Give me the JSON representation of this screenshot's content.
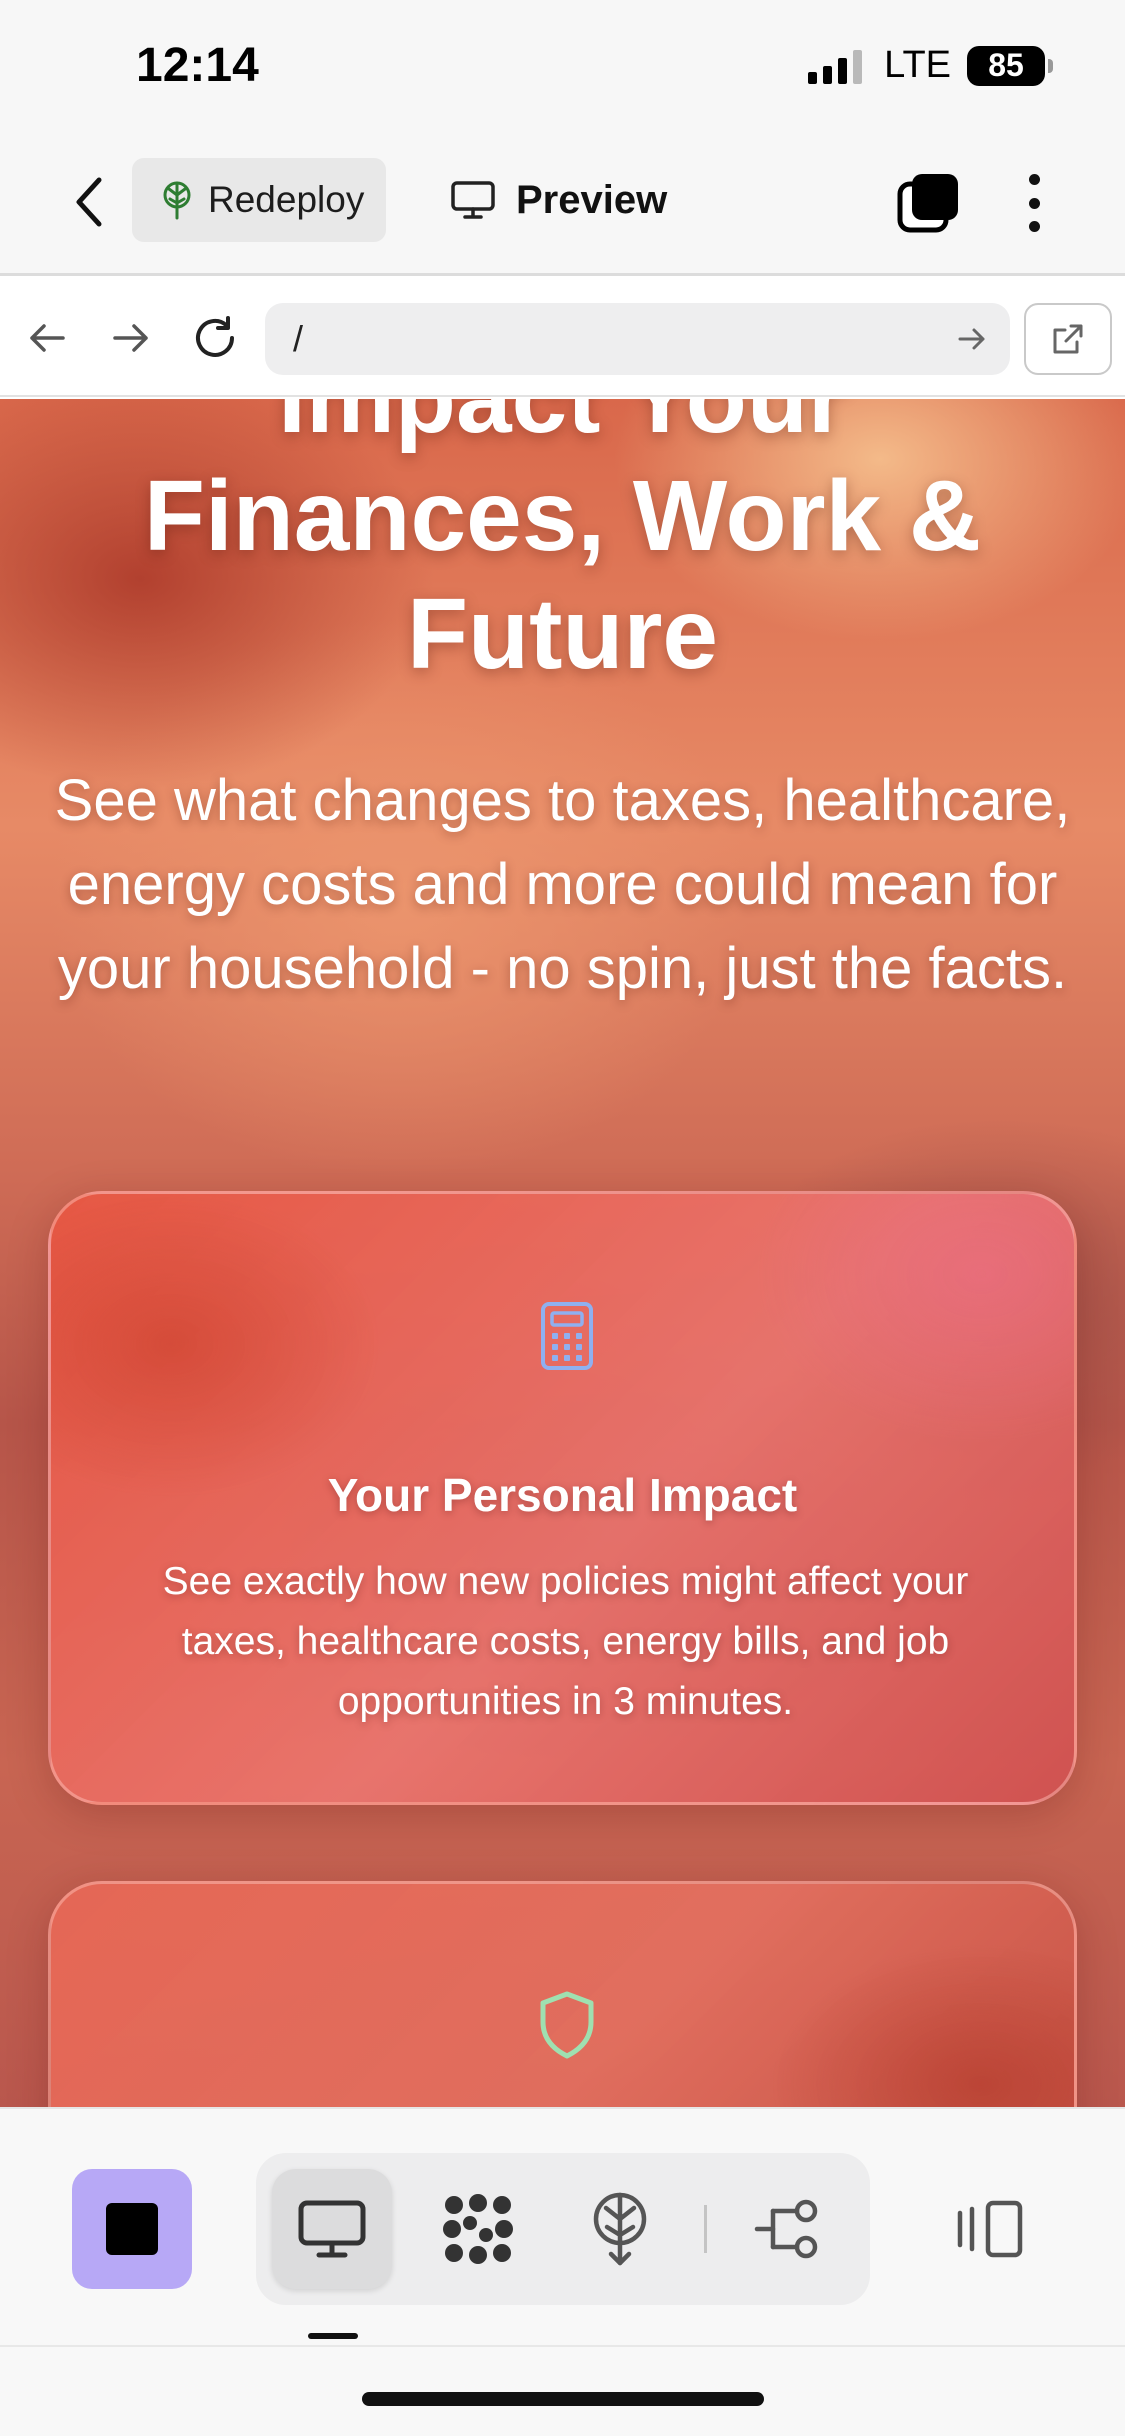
{
  "status_bar": {
    "time": "12:14",
    "network": "LTE",
    "battery": "85"
  },
  "app_bar": {
    "redeploy_label": "Redeploy",
    "preview_label": "Preview"
  },
  "browser": {
    "url": "/"
  },
  "hero": {
    "title_line_1": "Impact Your",
    "title_line_2": "Finances, Work &",
    "title_line_3": "Future",
    "subtitle": "See what changes to taxes, healthcare, energy costs and more could mean for your household - no spin, just the facts."
  },
  "cards": [
    {
      "icon": "calculator-icon",
      "title": "Your Personal Impact",
      "text": "See exactly how new policies might affect your taxes, healthcare costs, energy bills, and job opportunities in 3 minutes."
    },
    {
      "icon": "shield-icon"
    }
  ],
  "colors": {
    "stop_button": "#b7a8f6",
    "calculator_icon": "#8fb0f0",
    "shield_icon": "#9fe0b0",
    "redeploy_icon": "#2e7d32"
  }
}
